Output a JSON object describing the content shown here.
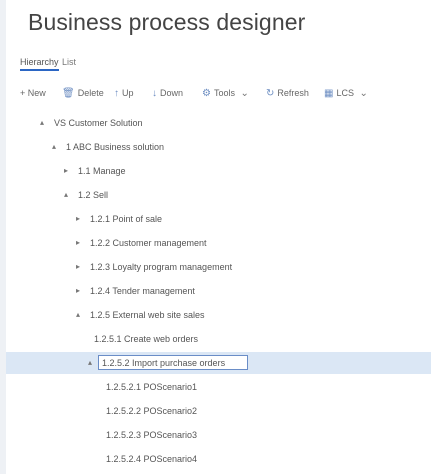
{
  "page": {
    "title": "Business process designer"
  },
  "tabs": [
    {
      "label": "Hierarchy"
    },
    {
      "label": "List"
    }
  ],
  "toolbar": {
    "new": "+ New",
    "delete": "Delete",
    "up": "Up",
    "down": "Down",
    "tools": "Tools",
    "refresh": "Refresh",
    "lcs": "LCS"
  },
  "tree": {
    "rows": [
      {
        "label": "VS Customer Solution",
        "expanded": true
      },
      {
        "label": "1 ABC Business solution",
        "expanded": true
      },
      {
        "label": "1.1 Manage",
        "expanded": false
      },
      {
        "label": "1.2 Sell",
        "expanded": true
      },
      {
        "label": "1.2.1 Point of sale",
        "expanded": false
      },
      {
        "label": "1.2.2 Customer management",
        "expanded": false
      },
      {
        "label": "1.2.3 Loyalty program management",
        "expanded": false
      },
      {
        "label": "1.2.4 Tender management",
        "expanded": false
      },
      {
        "label": "1.2.5 External web site sales",
        "expanded": true
      },
      {
        "label": "1.2.5.1 Create web orders",
        "leaf": true
      },
      {
        "label": "1.2.5.2 Import purchase orders",
        "expanded": true,
        "selected": true
      },
      {
        "label": "1.2.5.2.1 POScenario1",
        "leaf": true
      },
      {
        "label": "1.2.5.2.2 POScenario2",
        "leaf": true
      },
      {
        "label": "1.2.5.2.3 POScenario3",
        "leaf": true
      },
      {
        "label": "1.2.5.2.4 POScenario4",
        "leaf": true
      }
    ]
  },
  "colors": {
    "accent": "#2b66c4",
    "selected_bg": "#dbe7f5",
    "selected_border": "#6a8dc7"
  }
}
